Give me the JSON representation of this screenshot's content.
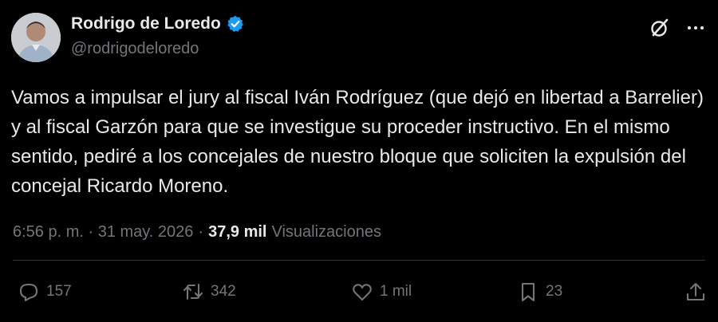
{
  "author": {
    "name": "Rodrigo de Loredo",
    "handle": "@rodrigodeloredo",
    "verified": true
  },
  "tweet": {
    "text": "Vamos a impulsar el jury al fiscal Iván Rodríguez (que dejó en libertad a Barrelier) y al fiscal Garzón para que se investigue su proceder instructivo. En el mismo sentido, pediré a los concejales de nuestro bloque que soliciten la expulsión del concejal Ricardo Moreno."
  },
  "meta": {
    "timestamp": "6:56 p. m. · 31 may. 2026",
    "separator": "·",
    "views_count": "37,9 mil",
    "views_label": "Visualizaciones"
  },
  "actions": {
    "replies": "157",
    "retweets": "342",
    "likes": "1 mil",
    "bookmarks": "23"
  },
  "colors": {
    "background": "#000000",
    "text": "#e7e9ea",
    "muted": "#71767b",
    "verified": "#1d9bf0",
    "divider": "#2f3336"
  },
  "icons": {
    "verified": "verified-badge-icon",
    "grok": "grok-icon",
    "more": "more-icon",
    "reply": "reply-icon",
    "retweet": "retweet-icon",
    "like": "heart-icon",
    "bookmark": "bookmark-icon",
    "share": "share-icon"
  }
}
